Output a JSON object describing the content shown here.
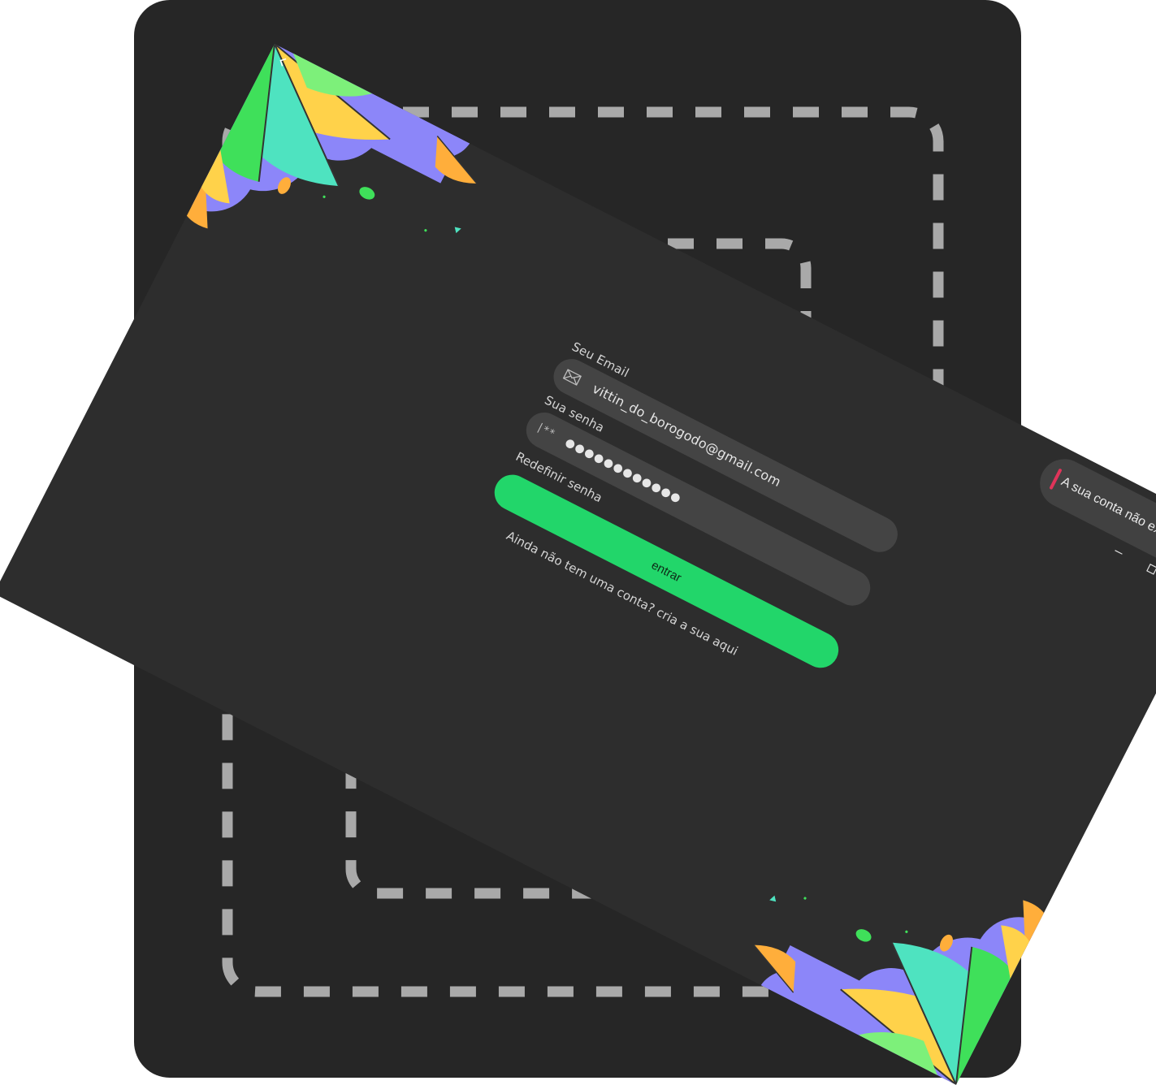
{
  "form": {
    "email_label": "Seu Email",
    "email_value": "vittin_do_borogodo@gmail.com",
    "password_label": "Sua senha",
    "password_icon": "|**",
    "password_value": "●●●●●●●●●●●●",
    "reset_link": "Redefinir senha",
    "submit_label": "entrar",
    "signup_link": "Ainda não tem uma conta? cria a sua aqui"
  },
  "toast": {
    "message": "A sua conta não existe",
    "accent_color": "#e0345a"
  },
  "icons": {
    "email": "envelope-icon",
    "password": "password-mask-icon",
    "back": "chevron-left-icon",
    "toast_close": "close-circle-icon",
    "minimize": "minimize-icon",
    "maximize": "maximize-icon",
    "close": "close-icon"
  },
  "colors": {
    "window_bg": "#2d2d2d",
    "input_bg": "#444444",
    "accent_green": "#22d66a",
    "purple": "#8c86f9",
    "yellow": "#ffd24a",
    "teal": "#4ee3c0",
    "green": "#3fe05a",
    "orange": "#ffae3b"
  }
}
